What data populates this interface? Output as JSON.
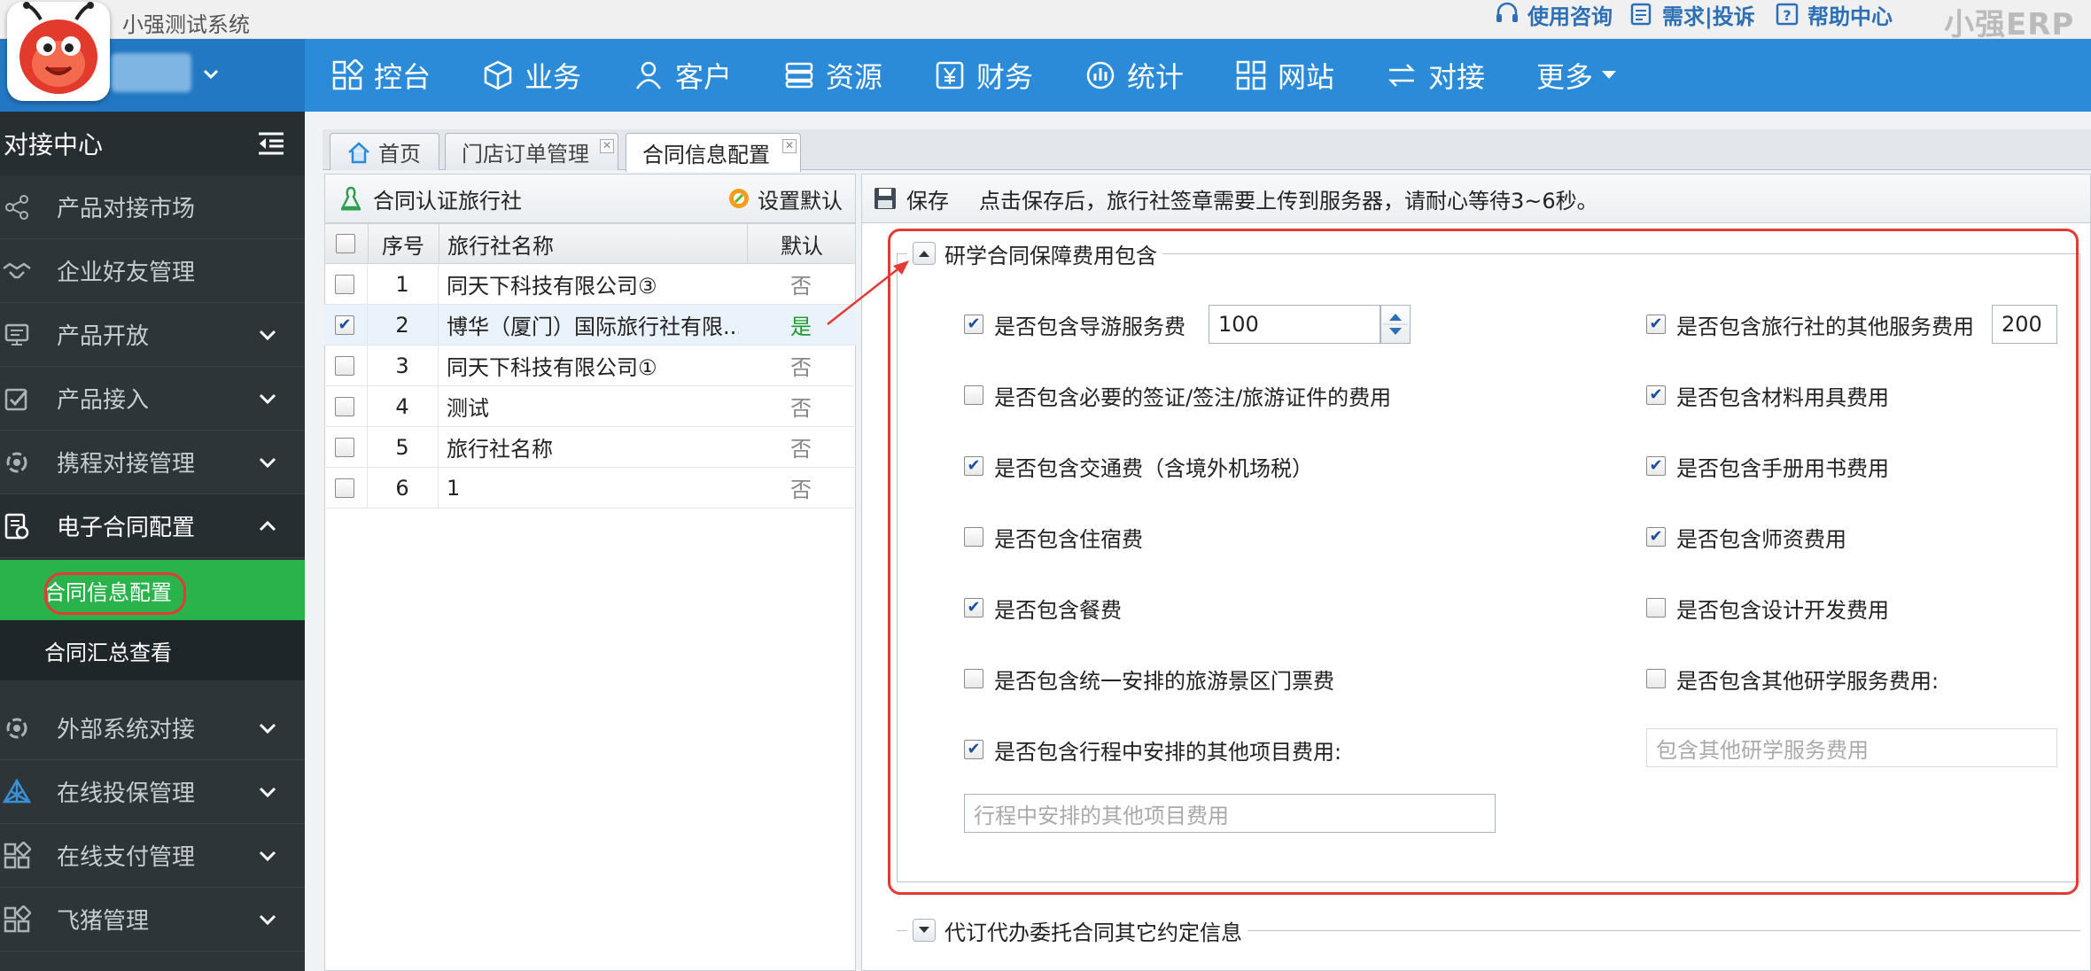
{
  "topbar": {
    "app_name": "小强测试系统",
    "links": [
      {
        "label": "使用咨询",
        "icon": "headset-icon"
      },
      {
        "label": "需求|投诉",
        "icon": "feedback-icon"
      },
      {
        "label": "帮助中心",
        "icon": "help-icon"
      }
    ],
    "brand": "小强ERP"
  },
  "nav": {
    "items": [
      {
        "label": "控台",
        "icon": "dashboard-icon"
      },
      {
        "label": "业务",
        "icon": "box-icon"
      },
      {
        "label": "客户",
        "icon": "user-icon"
      },
      {
        "label": "资源",
        "icon": "stack-icon"
      },
      {
        "label": "财务",
        "icon": "yen-icon"
      },
      {
        "label": "统计",
        "icon": "chart-icon"
      },
      {
        "label": "网站",
        "icon": "grid-icon"
      },
      {
        "label": "对接",
        "icon": "exchange-icon"
      },
      {
        "label": "更多",
        "icon": "caret-down-icon"
      }
    ]
  },
  "sidebar": {
    "title": "对接中心",
    "items": [
      {
        "label": "产品对接市场",
        "icon": "share-icon"
      },
      {
        "label": "企业好友管理",
        "icon": "handshake-icon"
      },
      {
        "label": "产品开放",
        "icon": "monitor-icon"
      },
      {
        "label": "产品接入",
        "icon": "checklist-icon"
      },
      {
        "label": "携程对接管理",
        "icon": "settings-icon"
      },
      {
        "label": "电子合同配置",
        "icon": "contract-icon"
      },
      {
        "label": "外部系统对接",
        "icon": "settings-icon"
      },
      {
        "label": "在线投保管理",
        "icon": "network-icon"
      },
      {
        "label": "在线支付管理",
        "icon": "grid-icon"
      },
      {
        "label": "飞猪管理",
        "icon": "grid-icon"
      }
    ],
    "subitems": [
      {
        "label": "合同信息配置",
        "active": true
      },
      {
        "label": "合同汇总查看",
        "active": false
      }
    ]
  },
  "tabs": [
    {
      "label": "首页",
      "icon": "home-icon"
    },
    {
      "label": "门店订单管理",
      "closable": true
    },
    {
      "label": "合同信息配置",
      "closable": true,
      "active": true
    }
  ],
  "left_panel": {
    "title": "合同认证旅行社",
    "set_default": "设置默认",
    "columns": [
      "序号",
      "旅行社名称",
      "默认"
    ],
    "rows": [
      {
        "no": "1",
        "name": "同天下科技有限公司③",
        "default": "否",
        "checked": false
      },
      {
        "no": "2",
        "name": "博华（厦门）国际旅行社有限...",
        "default": "是",
        "checked": true
      },
      {
        "no": "3",
        "name": "同天下科技有限公司①",
        "default": "否",
        "checked": false
      },
      {
        "no": "4",
        "name": "测试",
        "default": "否",
        "checked": false
      },
      {
        "no": "5",
        "name": "旅行社名称",
        "default": "否",
        "checked": false
      },
      {
        "no": "6",
        "name": "1",
        "default": "否",
        "checked": false
      }
    ]
  },
  "right_panel": {
    "save": "保存",
    "notice": "点击保存后，旅行社签章需要上传到服务器，请耐心等待3~6秒。",
    "section1": {
      "title": "研学合同保障费用包含",
      "left_options": [
        {
          "label": "是否包含导游服务费",
          "checked": true
        },
        {
          "label": "是否包含必要的签证/签注/旅游证件的费用",
          "checked": false
        },
        {
          "label": "是否包含交通费（含境外机场税）",
          "checked": true
        },
        {
          "label": "是否包含住宿费",
          "checked": false
        },
        {
          "label": "是否包含餐费",
          "checked": true
        },
        {
          "label": "是否包含统一安排的旅游景区门票费",
          "checked": false
        },
        {
          "label": "是否包含行程中安排的其他项目费用:",
          "checked": true
        }
      ],
      "right_options": [
        {
          "label": "是否包含旅行社的其他服务费用",
          "checked": true
        },
        {
          "label": "是否包含材料用具费用",
          "checked": true
        },
        {
          "label": "是否包含手册用书费用",
          "checked": true
        },
        {
          "label": "是否包含师资费用",
          "checked": true
        },
        {
          "label": "是否包含设计开发费用",
          "checked": false
        },
        {
          "label": "是否包含其他研学服务费用:",
          "checked": false
        }
      ],
      "guide_fee": "100",
      "agency_fee": "200",
      "other_items_placeholder": "行程中安排的其他项目费用",
      "other_study_placeholder": "包含其他研学服务费用"
    },
    "section2": {
      "title": "代订代办委托合同其它约定信息"
    }
  },
  "colors": {
    "nav_blue": "#2b8bd9",
    "sidebar": "#2d3539",
    "active_green": "#2ab24b",
    "annotation_red": "#e53935",
    "yes_green": "#1f9a2e"
  }
}
